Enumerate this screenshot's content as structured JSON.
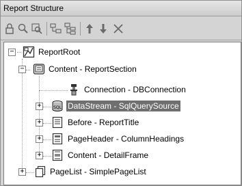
{
  "panel": {
    "title": "Report Structure"
  },
  "toolbar": {
    "buttons": [
      "lock-icon",
      "zoom-icon",
      "find-icon",
      "tree-collapse-icon",
      "tree-expand-icon",
      "move-up-icon",
      "move-down-icon",
      "delete-icon"
    ]
  },
  "tree": {
    "items": [
      {
        "label": "ReportRoot",
        "expanded": true
      },
      {
        "label": "Content - ReportSection",
        "expanded": true
      },
      {
        "label": "Connection - DBConnection"
      },
      {
        "label": "DataStream - SqlQuerySource",
        "selected": true
      },
      {
        "label": "Before - ReportTitle"
      },
      {
        "label": "PageHeader - ColumnHeadings"
      },
      {
        "label": "Content - DetailFrame"
      },
      {
        "label": "PageList - SimplePageList"
      }
    ]
  },
  "colors": {
    "selection": "#6f6f6f",
    "panel": "#d4d4d4"
  }
}
